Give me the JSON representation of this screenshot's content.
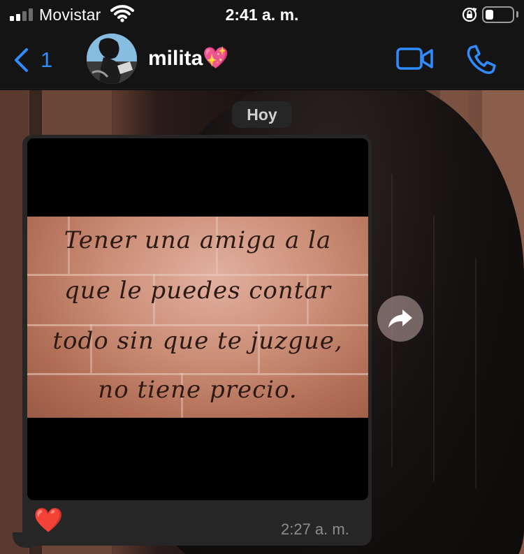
{
  "status_bar": {
    "carrier": "Movistar",
    "time": "2:41 a. m.",
    "signal_bars_filled": 2,
    "signal_bars_total": 4,
    "battery_level": 0.3
  },
  "header": {
    "unread_count": "1",
    "contact_name": "milita💖",
    "icons": [
      "back-chevron-icon",
      "video-camera-icon",
      "phone-icon"
    ]
  },
  "conversation": {
    "date_label": "Hoy",
    "message": {
      "image_quote_lines": [
        "Tener una amiga a la",
        "que le puedes contar",
        "todo sin que te juzgue,",
        "no tiene precio."
      ],
      "reaction": "❤️",
      "time": "2:27 a. m."
    }
  },
  "colors": {
    "accent": "#2f8cff",
    "header_bg": "#141414",
    "bubble_bg": "#262626",
    "timestamp": "#8d8d8d"
  }
}
